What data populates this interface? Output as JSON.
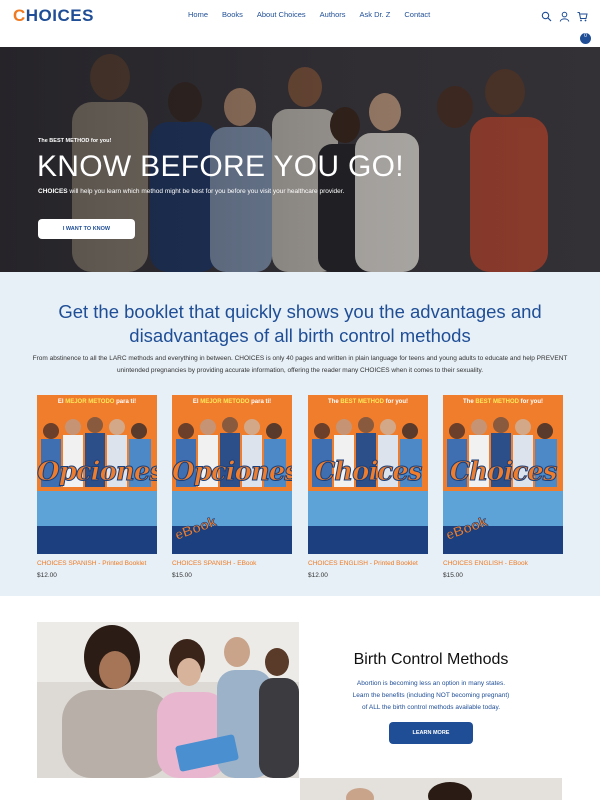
{
  "header": {
    "logo_first": "C",
    "logo_rest": "HOICES",
    "nav": [
      "Home",
      "Books",
      "About Choices",
      "Authors",
      "Ask Dr. Z",
      "Contact"
    ],
    "cart_count": "0",
    "icons": [
      "search-icon",
      "user-icon",
      "cart-icon"
    ]
  },
  "hero": {
    "kicker": "The BEST METHOD for you!",
    "title": "KNOW BEFORE YOU GO!",
    "subtitle_bold": "CHOICES",
    "subtitle_rest": " will help you learn which method might be best for you before you visit your healthcare provider.",
    "button": "I WANT TO KNOW"
  },
  "booklet": {
    "heading": "Get the booklet that quickly shows you the advantages and disadvantages of all birth control methods",
    "description": "From abstinence to all the LARC methods and everything in between. CHOICES is only 40 pages and written in plain language for teens and young adults to educate and help PREVENT unintended pregnancies by providing accurate information, offering the reader many CHOICES when it comes to their sexuality.",
    "products": [
      {
        "title": "CHOICES SPANISH - Printed Booklet",
        "price": "$12.00",
        "cover_brand": "Opciones",
        "kicker_pre": "El ",
        "kicker_hi": "MEJOR METODO",
        "kicker_post": " para ti!",
        "ebook": ""
      },
      {
        "title": "CHOICES SPANISH - EBook",
        "price": "$15.00",
        "cover_brand": "Opciones",
        "kicker_pre": "El ",
        "kicker_hi": "MEJOR METODO",
        "kicker_post": " para ti!",
        "ebook": "eBook"
      },
      {
        "title": "CHOICES ENGLISH - Printed Booklet",
        "price": "$12.00",
        "cover_brand": "Choices",
        "kicker_pre": "The ",
        "kicker_hi": "BEST METHOD",
        "kicker_post": " for you!",
        "ebook": ""
      },
      {
        "title": "CHOICES ENGLISH - EBook",
        "price": "$15.00",
        "cover_brand": "Choices",
        "kicker_pre": "The ",
        "kicker_hi": "BEST METHOD",
        "kicker_post": " for you!",
        "ebook": "eBook"
      }
    ]
  },
  "methods": {
    "title": "Birth Control Methods",
    "line1": "Abortion is becoming less an option in many states.",
    "line2": "Learn the benefits (including NOT becoming pregnant)",
    "line3": "of ALL the birth control methods available today.",
    "button": "LEARN MORE"
  },
  "colors": {
    "brand_blue": "#1f4e96",
    "brand_orange": "#f07a22",
    "section_bg": "#e7f0f7"
  }
}
